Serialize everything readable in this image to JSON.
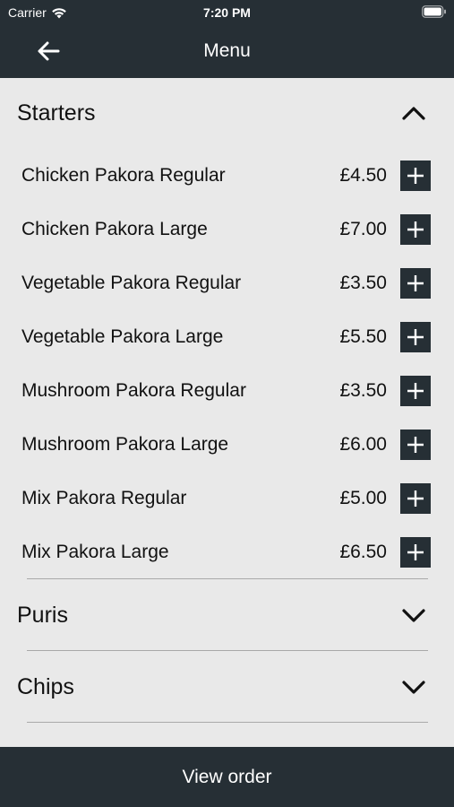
{
  "status_bar": {
    "carrier": "Carrier",
    "time": "7:20 PM"
  },
  "nav": {
    "title": "Menu",
    "back_icon": "arrow-left-icon"
  },
  "sections": [
    {
      "title": "Starters",
      "expanded": true,
      "items": [
        {
          "name": "Chicken Pakora Regular",
          "price": "£4.50"
        },
        {
          "name": "Chicken Pakora Large",
          "price": "£7.00"
        },
        {
          "name": "Vegetable Pakora Regular",
          "price": "£3.50"
        },
        {
          "name": "Vegetable Pakora Large",
          "price": "£5.50"
        },
        {
          "name": "Mushroom Pakora Regular",
          "price": "£3.50"
        },
        {
          "name": "Mushroom Pakora Large",
          "price": "£6.00"
        },
        {
          "name": "Mix Pakora Regular",
          "price": "£5.00"
        },
        {
          "name": "Mix Pakora Large",
          "price": "£6.50"
        }
      ]
    },
    {
      "title": "Puris",
      "expanded": false
    },
    {
      "title": "Chips",
      "expanded": false
    }
  ],
  "footer": {
    "view_order_label": "View order"
  },
  "colors": {
    "bar": "#262f35",
    "background": "#e9e9e9",
    "divider": "#a9a9a9"
  }
}
